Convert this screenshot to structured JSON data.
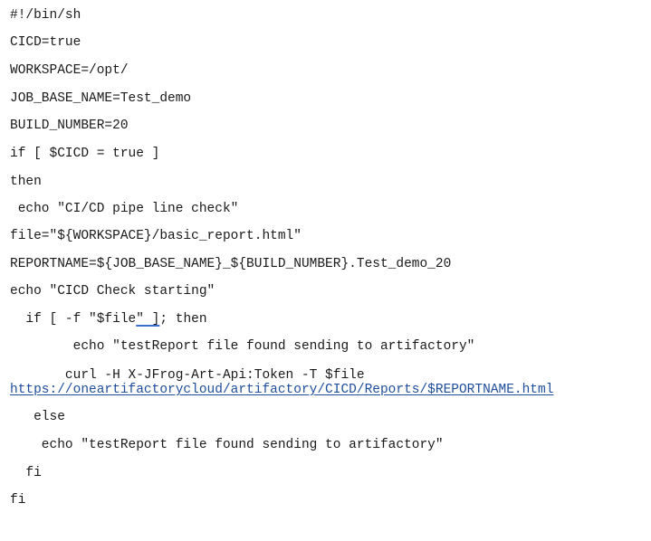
{
  "script": {
    "l01": "#!/bin/sh",
    "l02": "CICD=true",
    "l03": "WORKSPACE=/opt/",
    "l04": "JOB_BASE_NAME=Test_demo",
    "l05": "BUILD_NUMBER=20",
    "l06": "if [ $CICD = true ]",
    "l07": "then",
    "l08": " echo \"CI/CD pipe line check\"",
    "l09": "file=\"${WORKSPACE}/basic_report.html\"",
    "l10": "REPORTNAME=${JOB_BASE_NAME}_${BUILD_NUMBER}.Test_demo_20",
    "l11": "echo \"CICD Check starting\"",
    "l12a": "  if [ -f \"$file",
    "l12b": "\" ]",
    "l12c": "; then",
    "l13": "        echo \"testReport file found sending to artifactory\"",
    "l14": "       curl -H X-JFrog-Art-Api:Token -T $file",
    "l15": "https://oneartifactorycloud/artifactory/CICD/Reports/$REPORTNAME.html",
    "l16": "   else",
    "l17": "    echo \"testReport file found sending to artifactory\"",
    "l18": "  fi",
    "l19": "fi"
  }
}
